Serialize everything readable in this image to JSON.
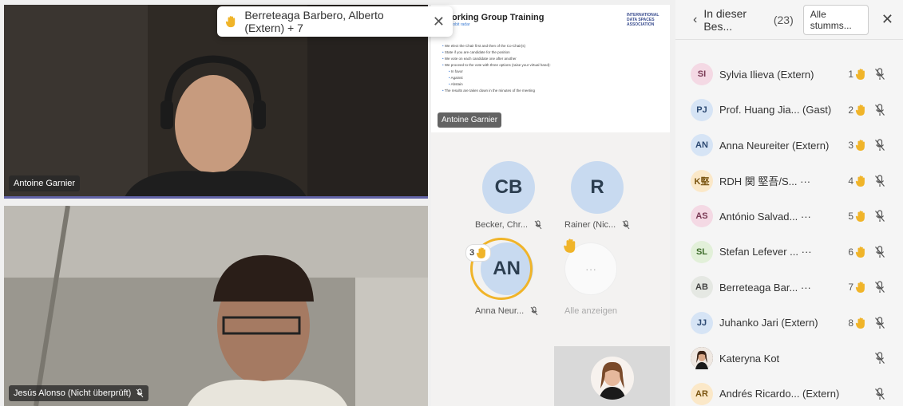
{
  "notification": {
    "text": "Berreteaga Barbero, Alberto (Extern) + 7",
    "close": "✕"
  },
  "video_top": {
    "name": "Antoine Garnier"
  },
  "video_bottom": {
    "name": "Jesús Alonso (Nicht überprüft)"
  },
  "slide": {
    "title": "orking Group Training",
    "subtitle": "tobit radar",
    "logo": "INTERNATIONAL DATA SPACES ASSOCIATION",
    "bullets": [
      "We elect the Chair first and then of the Co-Chair(s)",
      "State if you are candidate for the position",
      "We vote on each candidate one after another",
      "We proceed to the vote with three options (raise your virtual hand):"
    ],
    "subbullets": [
      "In favor",
      "Against",
      "Abstain"
    ],
    "last": "The results are taken down in the minutes of the meeting",
    "presenter": "Antoine Garnier"
  },
  "grid": {
    "p1": {
      "initials": "CB",
      "name": "Becker, Chr..."
    },
    "p2": {
      "initials": "R",
      "name": "Rainer (Nic..."
    },
    "p3": {
      "initials": "AN",
      "name": "Anna Neur...",
      "hand_num": "3"
    },
    "more": {
      "label": "Alle anzeigen",
      "dots": "···"
    }
  },
  "panel": {
    "back": "‹",
    "title": "In dieser Bes...",
    "count": "(23)",
    "mute_all": "Alle stumms...",
    "close": "✕",
    "participants": [
      {
        "initials": "SI",
        "name": "Sylvia Ilieva (Extern)",
        "hand": "1",
        "color": "#f4d9e4",
        "text": "#7a3a55"
      },
      {
        "initials": "PJ",
        "name": "Prof. Huang Jia... (Gast)",
        "hand": "2",
        "color": "#d6e4f5",
        "text": "#2d4a73"
      },
      {
        "initials": "AN",
        "name": "Anna Neureiter (Extern)",
        "hand": "3",
        "color": "#d6e4f5",
        "text": "#2d4a73"
      },
      {
        "initials": "K堅",
        "name": "RDH 関 堅吾/S... ···",
        "hand": "4",
        "color": "#fbe8c8",
        "text": "#7a5410"
      },
      {
        "initials": "AS",
        "name": "António Salvad... ···",
        "hand": "5",
        "color": "#f4d9e4",
        "text": "#7a3a55"
      },
      {
        "initials": "SL",
        "name": "Stefan Lefever ... ···",
        "hand": "6",
        "color": "#e2f0d9",
        "text": "#3d6b2a"
      },
      {
        "initials": "AB",
        "name": "Berreteaga Bar... ···",
        "hand": "7",
        "color": "#e5e8e3",
        "text": "#444"
      },
      {
        "initials": "JJ",
        "name": "Juhanko Jari (Extern)",
        "hand": "8",
        "color": "#d6e4f5",
        "text": "#2d4a73"
      },
      {
        "initials": "",
        "name": "Kateryna Kot",
        "hand": "",
        "color": "#3b2a22",
        "text": "#fff"
      },
      {
        "initials": "AR",
        "name": "Andrés Ricardo... (Extern)",
        "hand": "",
        "color": "#fbe8c8",
        "text": "#7a5410"
      }
    ]
  }
}
